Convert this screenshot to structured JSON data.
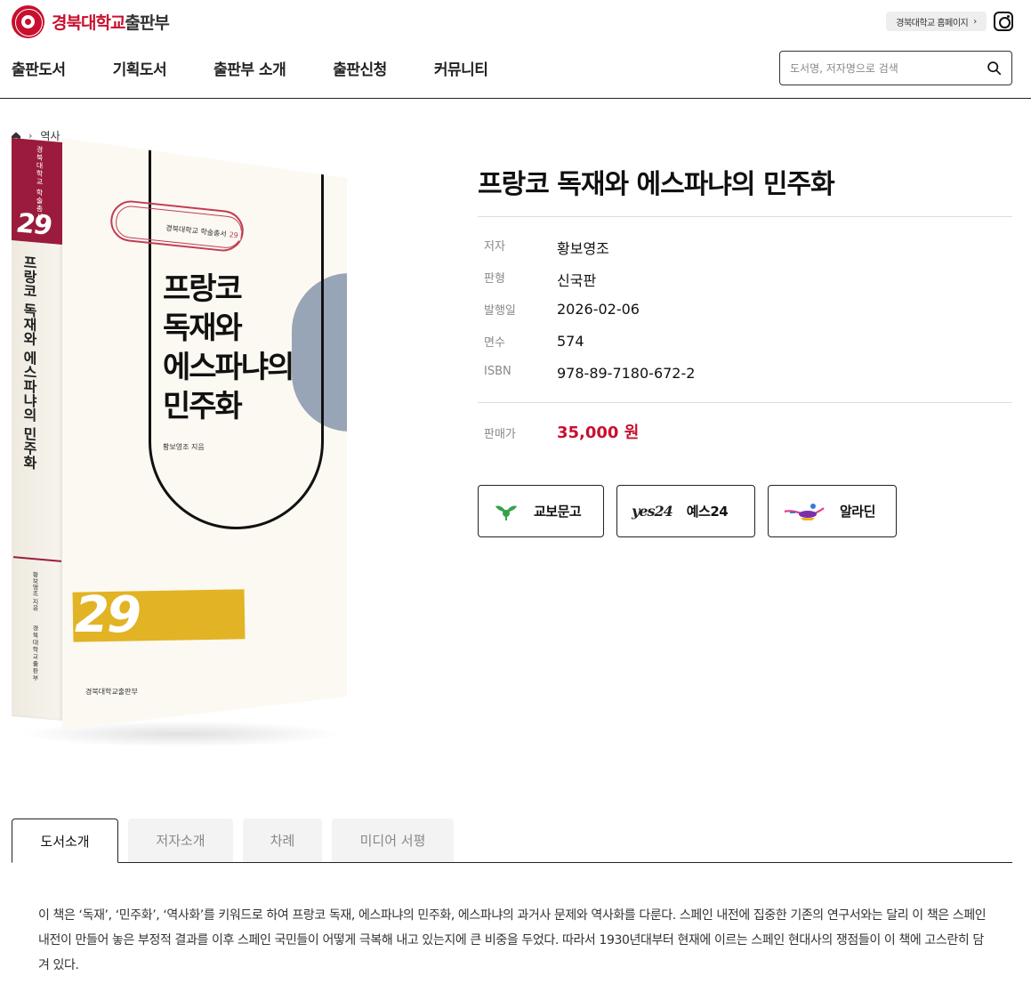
{
  "header": {
    "logo_part1": "경북대학교",
    "logo_part2": "출판부",
    "univ_link": "경북대학교 홈페이지",
    "univ_link_chevron": "›",
    "instagram_icon": "instagram-icon",
    "nav": [
      "출판도서",
      "기획도서",
      "출판부 소개",
      "출판신청",
      "커뮤니티"
    ],
    "search_placeholder": "도서명, 저자명으로 검색",
    "search_value": ""
  },
  "breadcrumb": {
    "home_icon": "home-icon",
    "separator": "›",
    "category": "역사"
  },
  "cover": {
    "spine_series": "경북대학교 학술총서",
    "spine_number": "29",
    "spine_title": "프랑코 독재와 에스파냐의 민주화",
    "spine_author": "황보영조 지음",
    "spine_publisher": "경북대학교출판부",
    "series_label": "경북대학교 학술총서",
    "series_number": "29",
    "title_line1": "프랑코",
    "title_line2": "독재와",
    "title_line3": "에스파냐의",
    "title_line4": "민주화",
    "author": "황보영조 지음",
    "big_number": "29",
    "publisher": "경북대학교출판부"
  },
  "book": {
    "title": "프랑코 독재와 에스파냐의 민주화",
    "info": [
      {
        "label": "저자",
        "value": "황보영조"
      },
      {
        "label": "판형",
        "value": "신국판"
      },
      {
        "label": "발행일",
        "value": "2026-02-06"
      },
      {
        "label": "면수",
        "value": "574"
      },
      {
        "label": "ISBN",
        "value": "978-89-7180-672-2"
      }
    ],
    "price_label": "판매가",
    "price": "35,000 원"
  },
  "stores": [
    {
      "label": "교보문고",
      "icon": "kyobo-logo-icon"
    },
    {
      "label": "예스24",
      "icon": "yes24-logo-icon",
      "logo_text": "yes24"
    },
    {
      "label": "알라딘",
      "icon": "aladin-lamp-icon"
    }
  ],
  "tabs": [
    {
      "label": "도서소개",
      "active": true
    },
    {
      "label": "저자소개",
      "active": false
    },
    {
      "label": "차례",
      "active": false
    },
    {
      "label": "미디어 서평",
      "active": false
    }
  ],
  "description": "이 책은 ‘독재’, ‘민주화’, ‘역사화’를 키워드로 하여 프랑코 독재, 에스파냐의 민주화, 에스파냐의 과거사 문제와 역사화를 다룬다. 스페인 내전에 집중한 기존의 연구서와는 달리 이 책은 스페인 내전이 만들어 놓은 부정적 결과를 이후 스페인 국민들이 어떻게 극복해 내고 있는지에 큰 비중을 두었다. 따라서 1930년대부터 현재에 이르는 스페인 현대사의 쟁점들이 이 책에 고스란히 담겨 있다.",
  "colors": {
    "brand_red": "#c8102e",
    "cover_maroon": "#9b1b3d",
    "cover_yellow": "#e2b324",
    "cover_gray": "#98a5b6"
  }
}
